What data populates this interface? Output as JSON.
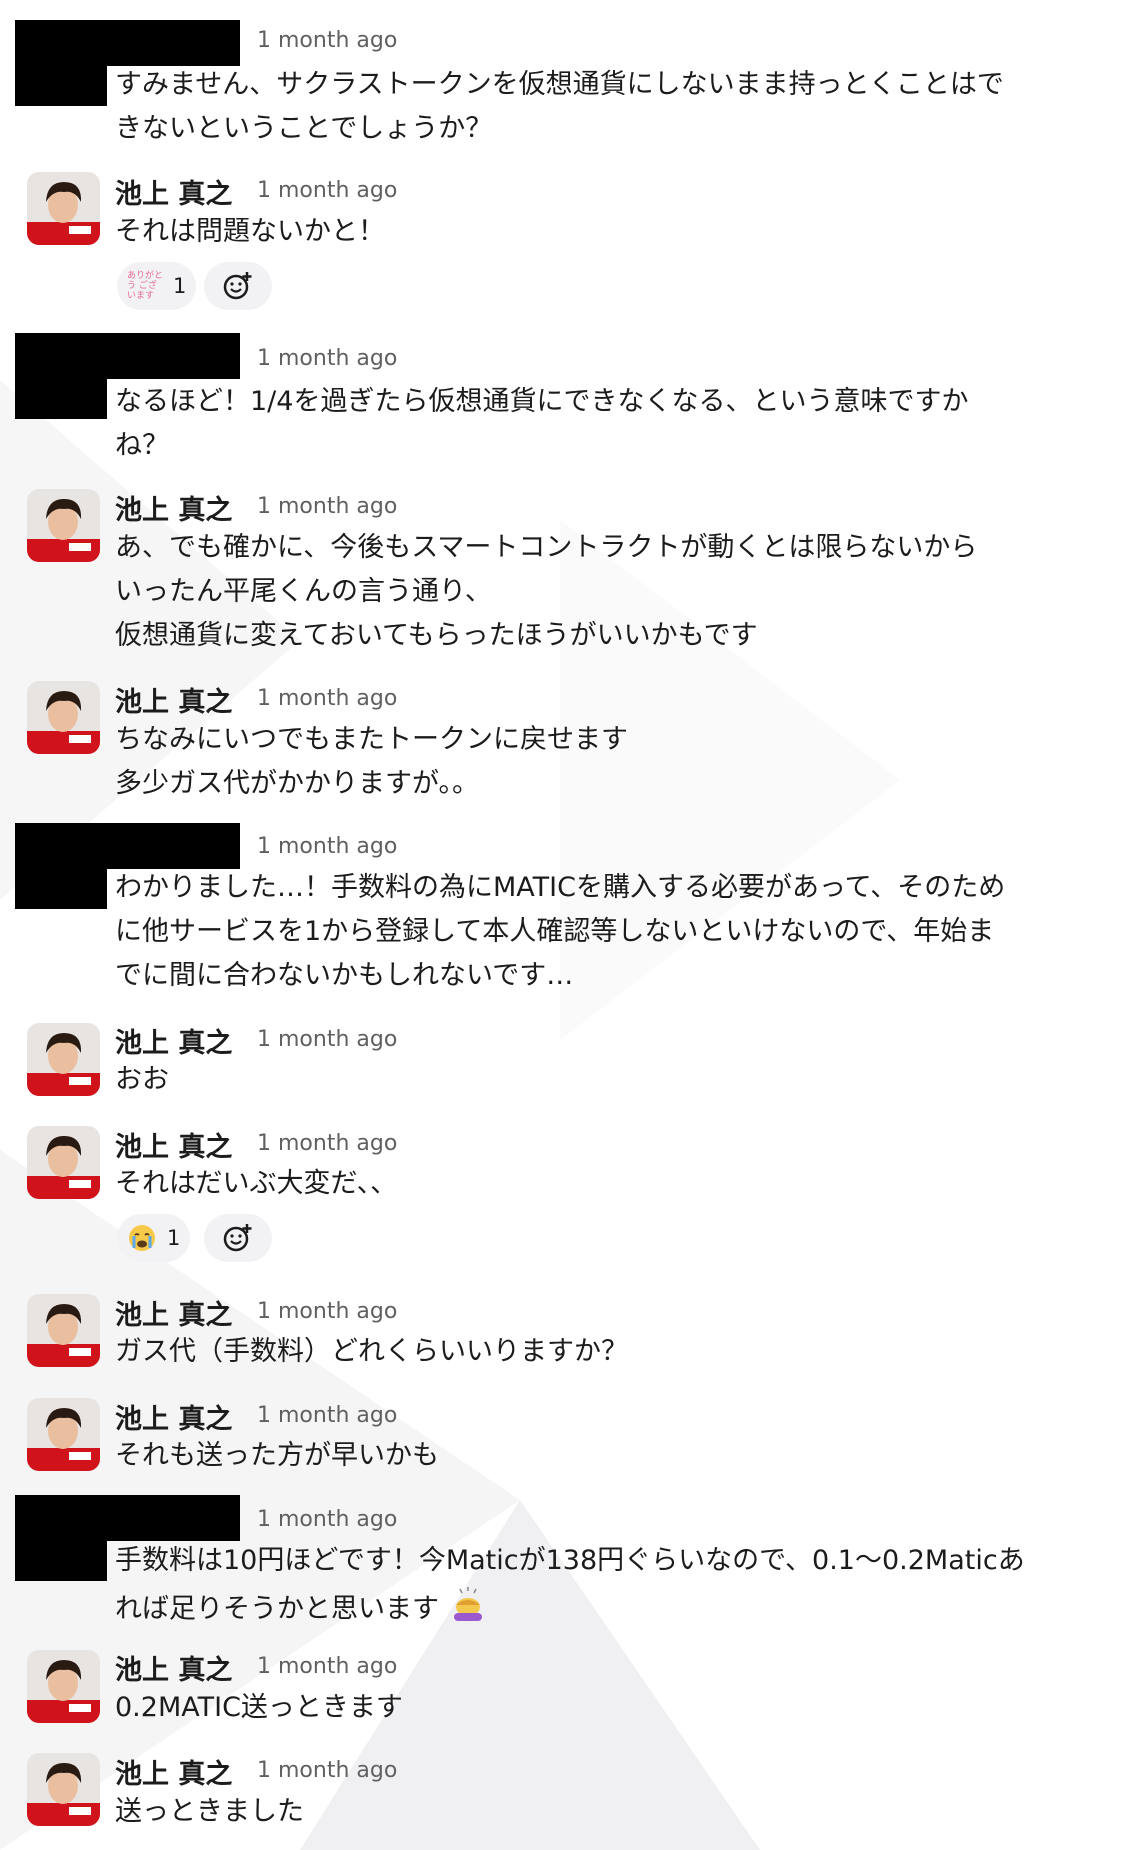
{
  "colors": {
    "text": "#1d1c1d",
    "timestamp": "#616061",
    "reaction_bg": "#f2f2f4",
    "redaction": "#000000"
  },
  "messages": [
    {
      "author": "",
      "redacted": true,
      "time": "1 month ago",
      "lines": [
        "すみません、サクラストークンを仮想通貨にしないまま持っとくことはで",
        "きないということでしょうか？"
      ]
    },
    {
      "author": "池上 真之",
      "time": "1 month ago",
      "lines": [
        "それは問題ないかと！"
      ],
      "reaction": {
        "icon": "arigatou-gozaimasu-emoji-icon",
        "count": "1",
        "emoji_text": "ありがとう ございます"
      }
    },
    {
      "author": "",
      "redacted": true,
      "time": "1 month ago",
      "lines": [
        "なるほど！1/4を過ぎたら仮想通貨にできなくなる、という意味ですか",
        "ね？"
      ]
    },
    {
      "author": "池上 真之",
      "time": "1 month ago",
      "lines": [
        "あ、でも確かに、今後もスマートコントラクトが動くとは限らないから",
        "いったん平尾くんの言う通り、",
        "仮想通貨に変えておいてもらったほうがいいかもです"
      ]
    },
    {
      "author": "池上 真之",
      "time": "1 month ago",
      "lines": [
        "ちなみにいつでもまたトークンに戻せます",
        "多少ガス代がかかりますが。。"
      ]
    },
    {
      "author": "",
      "redacted": true,
      "time": "1 month ago",
      "lines": [
        "わかりました…！手数料の為にMATICを購入する必要があって、そのため",
        "に他サービスを1から登録して本人確認等しないといけないので、年始ま",
        "でに間に合わないかもしれないです…"
      ]
    },
    {
      "author": "池上 真之",
      "time": "1 month ago",
      "lines": [
        "おお"
      ]
    },
    {
      "author": "池上 真之",
      "time": "1 month ago",
      "lines": [
        "それはだいぶ大変だ、、"
      ],
      "reaction": {
        "icon": "loudly-crying-face-icon",
        "count": "1"
      }
    },
    {
      "author": "池上 真之",
      "time": "1 month ago",
      "lines": [
        "ガス代（手数料）どれくらいいりますか？"
      ]
    },
    {
      "author": "池上 真之",
      "time": "1 month ago",
      "lines": [
        "それも送った方が早いかも"
      ]
    },
    {
      "author": "",
      "redacted": true,
      "time": "1 month ago",
      "lines": [
        "手数料は10円ほどです！今Maticが138円ぐらいなので、0.1〜0.2Maticあ",
        "れば足りそうかと思います"
      ]
    },
    {
      "author": "池上 真之",
      "time": "1 month ago",
      "lines": [
        "0.2MATIC送っときます"
      ]
    },
    {
      "author": "池上 真之",
      "time": "1 month ago",
      "lines": [
        "送っときました"
      ]
    }
  ]
}
